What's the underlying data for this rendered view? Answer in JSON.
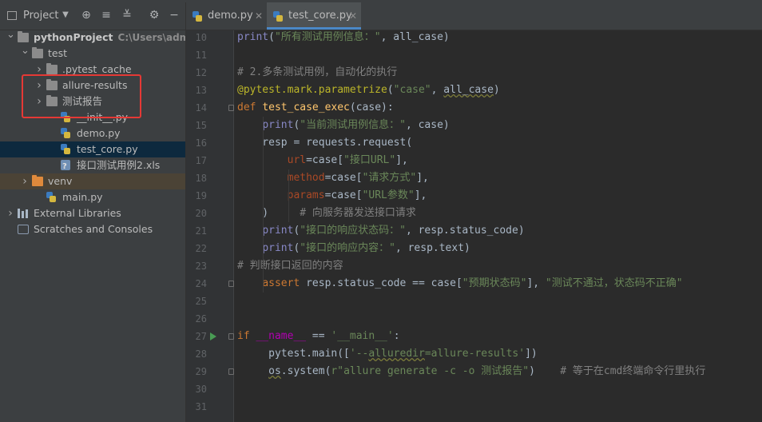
{
  "panel": {
    "title": "Project",
    "tree": [
      {
        "id": "python-project",
        "label": "pythonProject",
        "path": "C:\\Users\\admin\\",
        "depth": 0,
        "kind": "folder",
        "expanded": true,
        "bold": true
      },
      {
        "id": "test",
        "label": "test",
        "depth": 1,
        "kind": "folder",
        "expanded": true
      },
      {
        "id": "pytest-cache",
        "label": ".pytest_cache",
        "depth": 2,
        "kind": "folder",
        "expanded": false
      },
      {
        "id": "allure-results",
        "label": "allure-results",
        "depth": 2,
        "kind": "folder",
        "expanded": false
      },
      {
        "id": "test-report",
        "label": "测试报告",
        "depth": 2,
        "kind": "folder",
        "expanded": false
      },
      {
        "id": "init-py",
        "label": "__init__.py",
        "depth": 3,
        "kind": "py"
      },
      {
        "id": "demo-py",
        "label": "demo.py",
        "depth": 3,
        "kind": "py"
      },
      {
        "id": "test-core-py",
        "label": "test_core.py",
        "depth": 3,
        "kind": "py",
        "selected": true
      },
      {
        "id": "xls-file",
        "label": "接口测试用例2.xls",
        "depth": 3,
        "kind": "xls"
      },
      {
        "id": "venv",
        "label": "venv",
        "depth": 1,
        "kind": "folder-orange",
        "expanded": false
      },
      {
        "id": "main-py",
        "label": "main.py",
        "depth": 2,
        "kind": "py"
      },
      {
        "id": "external-libraries",
        "label": "External Libraries",
        "depth": 0,
        "kind": "lib",
        "expanded": false
      },
      {
        "id": "scratches",
        "label": "Scratches and Consoles",
        "depth": 0,
        "kind": "scratch"
      }
    ]
  },
  "tabs": [
    {
      "label": "demo.py",
      "active": false
    },
    {
      "label": "test_core.py",
      "active": true
    }
  ],
  "editor": {
    "lines": [
      {
        "n": "10",
        "html": "<span class=\"bi\">print</span>(<span class=\"str\">\"所有测试用例信息：\"</span>, all_case)"
      },
      {
        "n": "11",
        "html": ""
      },
      {
        "n": "12",
        "html": "<span class=\"cm\"># 2.多条测试用例，自动化的执行</span>"
      },
      {
        "n": "13",
        "html": "<span class=\"dec\">@pytest.mark.parametrize</span>(<span class=\"str\">\"case\"</span>, <span class=\"wavy\">all_case</span>)"
      },
      {
        "n": "14",
        "html": "<span class=\"kw\">def</span> <span class=\"fn\">test_case_exec</span>(case):"
      },
      {
        "n": "15",
        "html": "    <span class=\"bi\">print</span>(<span class=\"str\">\"当前测试用例信息：\"</span>, case)"
      },
      {
        "n": "16",
        "html": "    resp = requests.request("
      },
      {
        "n": "17",
        "html": "        <span class=\"prm\">url</span>=case[<span class=\"str\">\"接口URL\"</span>],"
      },
      {
        "n": "18",
        "html": "        <span class=\"prm\">method</span>=case[<span class=\"str\">\"请求方式\"</span>],"
      },
      {
        "n": "19",
        "html": "        <span class=\"prm\">params</span>=case[<span class=\"str\">\"URL参数\"</span>],"
      },
      {
        "n": "20",
        "html": "    )     <span class=\"cm\"># 向服务器发送接口请求</span>"
      },
      {
        "n": "21",
        "html": "    <span class=\"bi\">print</span>(<span class=\"str\">\"接口的响应状态码：\"</span>, resp.status_code)"
      },
      {
        "n": "22",
        "html": "    <span class=\"bi\">print</span>(<span class=\"str\">\"接口的响应内容：\"</span>, resp.text)"
      },
      {
        "n": "23",
        "html": "<span class=\"cm\"># 判断接口返回的内容</span>"
      },
      {
        "n": "24",
        "html": "    <span class=\"kw\">assert</span> resp.status_code == case[<span class=\"str\">\"预期状态码\"</span>], <span class=\"str\">\"测试不通过，状态码不正确\"</span>"
      },
      {
        "n": "25",
        "html": ""
      },
      {
        "n": "26",
        "html": ""
      },
      {
        "n": "27",
        "html": "<span class=\"kw\">if</span> <span class=\"mg\">__name__</span> == <span class=\"str\">'__main__'</span>:"
      },
      {
        "n": "28",
        "html": "     pytest.main([<span class=\"str\">'--<span class=\"wavy\">alluredir</span>=allure-results'</span>])"
      },
      {
        "n": "29",
        "html": "     <span class=\"wavy\">os</span>.system(<span class=\"str\">r\"allure generate -c -o 测试报告\"</span>)    <span class=\"cm\"># 等于在cmd终端命令行里执行</span>"
      },
      {
        "n": "30",
        "html": ""
      },
      {
        "n": "31",
        "html": ""
      }
    ]
  }
}
